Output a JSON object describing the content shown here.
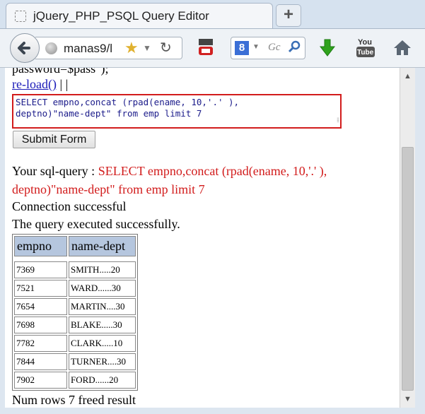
{
  "tab": {
    "title": "jQuery_PHP_PSQL Query Editor"
  },
  "newtab_label": "+",
  "toolbar": {
    "url": "manas9/l",
    "search_placeholder": "Gc",
    "search_engine": "8",
    "yt_small": "You Tube",
    "yt_big_top": "You",
    "yt_big_bottom": "Tube"
  },
  "page": {
    "password_line": "password=$pass\");",
    "reload_link": "re-load()",
    "reload_tail": " | |",
    "sql_text": "SELECT empno,concat (rpad(ename, 10,'.' ),\ndeptno)\"name-dept\" from emp limit 7",
    "submit_label": "Submit Form",
    "query_prefix": "Your sql-query : ",
    "query_part1": "SELECT empno,concat (rpad(ename, 10,'.' ),",
    "query_part2": "deptno)\"name-dept\" from emp limit 7",
    "connection": "Connection successful",
    "executed": "The query executed successfully.",
    "num_rows": "Num rows 7 freed result"
  },
  "table": {
    "headers": [
      "empno",
      "name-dept"
    ],
    "rows": [
      [
        "7369",
        "SMITH.....20"
      ],
      [
        "7521",
        "WARD......30"
      ],
      [
        "7654",
        "MARTIN....30"
      ],
      [
        "7698",
        "BLAKE.....30"
      ],
      [
        "7782",
        "CLARK.....10"
      ],
      [
        "7844",
        "TURNER....30"
      ],
      [
        "7902",
        "FORD......20"
      ]
    ]
  },
  "colors": {
    "accent_red": "#d21c1c",
    "link_blue": "#1a1ab8",
    "header_bg": "#b5c6de"
  }
}
